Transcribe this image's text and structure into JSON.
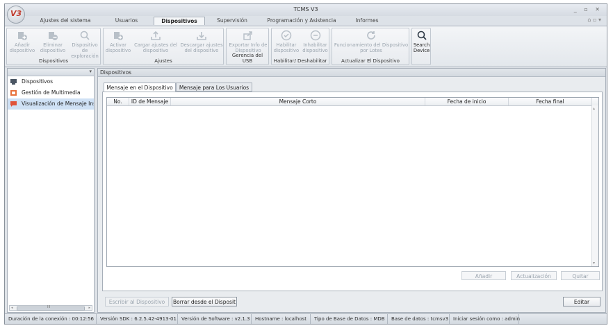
{
  "window": {
    "title": "TCMS V3",
    "logo_text": "V3",
    "controls": "_ ▫ ✕"
  },
  "tabs": [
    {
      "label": "Ajustes del sistema"
    },
    {
      "label": "Usuarios"
    },
    {
      "label": "Dispositivos"
    },
    {
      "label": "Supervisión"
    },
    {
      "label": "Programación y Asistencia"
    },
    {
      "label": "Informes"
    }
  ],
  "ribbon": {
    "groups": [
      {
        "label": "Dispositivos",
        "buttons": [
          {
            "label": "Añadir dispositivo"
          },
          {
            "label": "Eliminar dispositivo"
          },
          {
            "label": "Dispositivo de exploración"
          }
        ]
      },
      {
        "label": "Ajustes",
        "buttons": [
          {
            "label": "Activar dispositivo"
          },
          {
            "label": "Cargar ajustes del dispositivo"
          },
          {
            "label": "Descargar ajustes del dispositivo"
          }
        ]
      },
      {
        "label": "Gerencia del USB",
        "buttons": [
          {
            "label": "Exportar Info de Dispositivo"
          }
        ]
      },
      {
        "label": "Habilitar/ Deshabilitar",
        "buttons": [
          {
            "label": "Habilitar dispositivo"
          },
          {
            "label": "Inhabilitar dispositivo"
          }
        ]
      },
      {
        "label": "Actualizar El Dispositivo",
        "buttons": [
          {
            "label": "Funcionamiento del Dispositivo por Lotes"
          }
        ]
      },
      {
        "label": "",
        "buttons": [
          {
            "label": "Search Device"
          }
        ]
      }
    ]
  },
  "sidebar": {
    "pin": "▾",
    "items": [
      {
        "label": "Dispositivos"
      },
      {
        "label": "Gestión de Multimedia"
      },
      {
        "label": "Visualización de Mensaje Instantáneo"
      }
    ],
    "scroll_label": "III"
  },
  "content": {
    "header": "Dispositivos",
    "subtabs": [
      {
        "label": "Mensaje en el Dispositivo"
      },
      {
        "label": "Mensaje para Los Usuarios"
      }
    ],
    "table": {
      "columns": [
        "No.",
        "ID de Mensaje",
        "Mensaje Corto",
        "Fecha de inicio",
        "Fecha final"
      ]
    },
    "grid_buttons": {
      "add": "Añadir",
      "update": "Actualización",
      "remove": "Quitar"
    },
    "bottom_buttons": {
      "write": "Escribir al Dispositivo",
      "clear": "Borrar desde el Disposit",
      "edit": "Editar"
    }
  },
  "status": [
    "Duración de la conexión : 00:12:56",
    "Versión SDK : 6.2.5.42-4913-01",
    "Versión de Software : v2.1.3",
    "Hostname : localhost",
    "Tipo de Base de Datos : MDB",
    "Base de datos : tcmsv3",
    "Iniciar sesión como : admin"
  ],
  "colors": {
    "accent_orange": "#e8703a",
    "selection": "#cfe1f5",
    "disabled_text": "#9aa4ae"
  }
}
